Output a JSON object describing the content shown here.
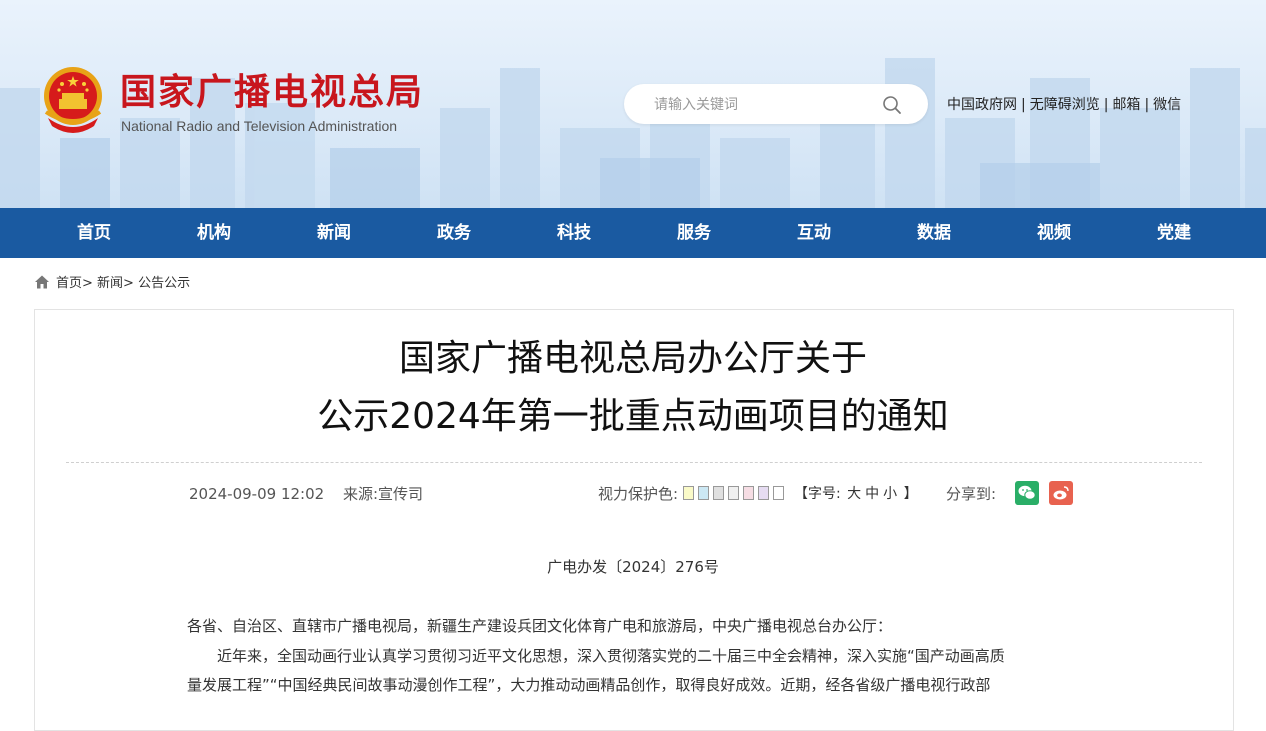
{
  "header": {
    "title": "国家广播电视总局",
    "subtitle": "National Radio and Television Administration",
    "search_placeholder": "请输入关键词",
    "links": [
      "中国政府网",
      "无障碍浏览",
      "邮箱",
      "微信"
    ],
    "link_separator": "|"
  },
  "nav": {
    "items": [
      "首页",
      "机构",
      "新闻",
      "政务",
      "科技",
      "服务",
      "互动",
      "数据",
      "视频",
      "党建"
    ]
  },
  "breadcrumb": {
    "items": [
      "首页>",
      "新闻>",
      "公告公示"
    ]
  },
  "article": {
    "title_line1": "国家广播电视总局办公厅关于",
    "title_line2": "公示2024年第一批重点动画项目的通知",
    "date": "2024-09-09 12:02",
    "source_label": "来源:",
    "source": "宣传司",
    "eye_care_label": "视力保护色:",
    "eye_care_colors": [
      "#fafac8",
      "#cce8f4",
      "#e0e0e0",
      "#f0f0f0",
      "#f6dde4",
      "#e6dcf2",
      "#ffffff"
    ],
    "font_size_open": "【字号:",
    "font_size_options": [
      "大",
      "中",
      "小"
    ],
    "font_size_close": "】",
    "share_label": "分享到:",
    "doc_number": "广电办发〔2024〕276号",
    "recipients": "各省、自治区、直辖市广播电视局，新疆生产建设兵团文化体育广电和旅游局，中央广播电视总台办公厅：",
    "body_line1": "近年来，全国动画行业认真学习贯彻习近平文化思想，深入贯彻落实党的二十届三中全会精神，深入实施“国产动画高质",
    "body_line2": "量发展工程”“中国经典民间故事动漫创作工程”，大力推动动画精品创作，取得良好成效。近期，经各省级广播电视行政部"
  },
  "colors": {
    "brand_red": "#c8161d",
    "nav_blue": "#1a5aa1",
    "wechat_green": "#2aae67",
    "weibo_red": "#e8624f"
  }
}
